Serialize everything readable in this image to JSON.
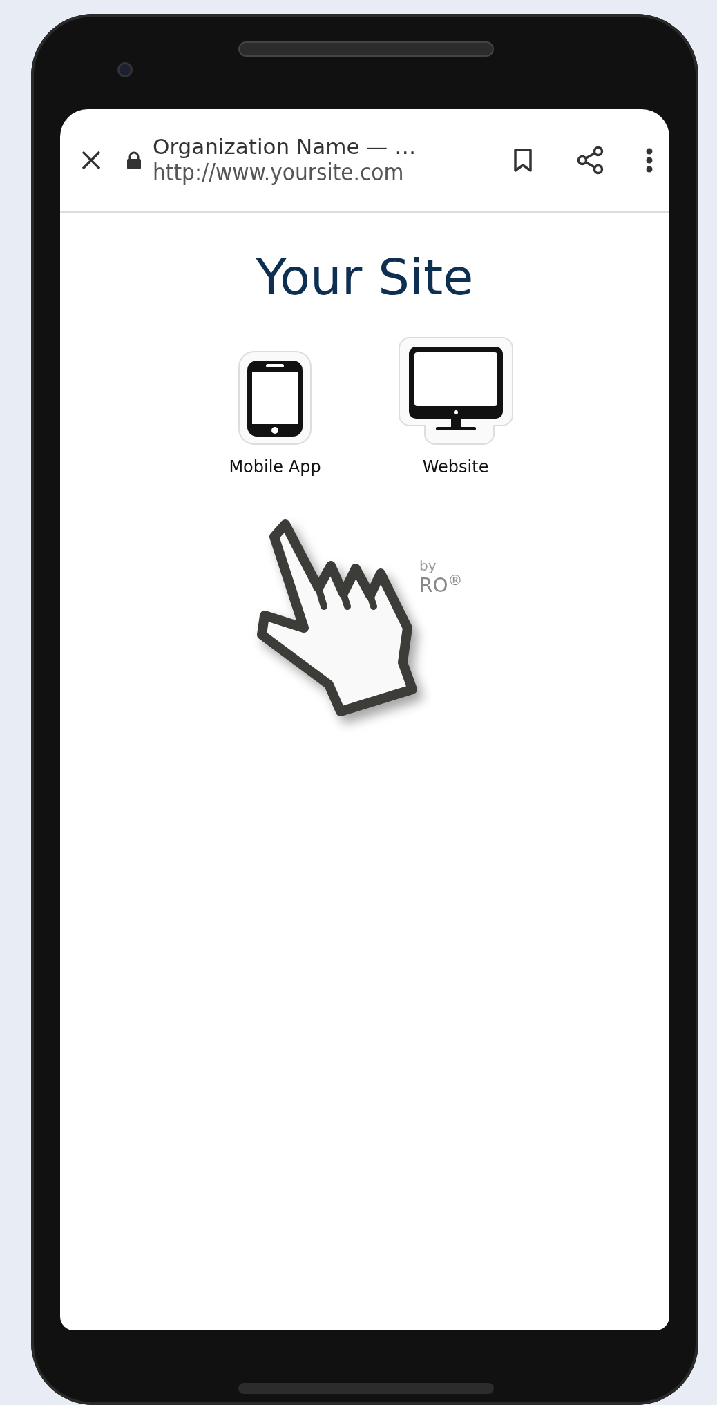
{
  "browser_bar": {
    "title": "Organization Name — …",
    "url": "http://www.yoursite.com"
  },
  "page": {
    "heading": "Your Site",
    "options": [
      {
        "label": "Mobile App",
        "kind": "phone"
      },
      {
        "label": "Website",
        "kind": "monitor"
      }
    ],
    "credit": {
      "by": "by",
      "brand": "RO$^{®}$"
    }
  }
}
